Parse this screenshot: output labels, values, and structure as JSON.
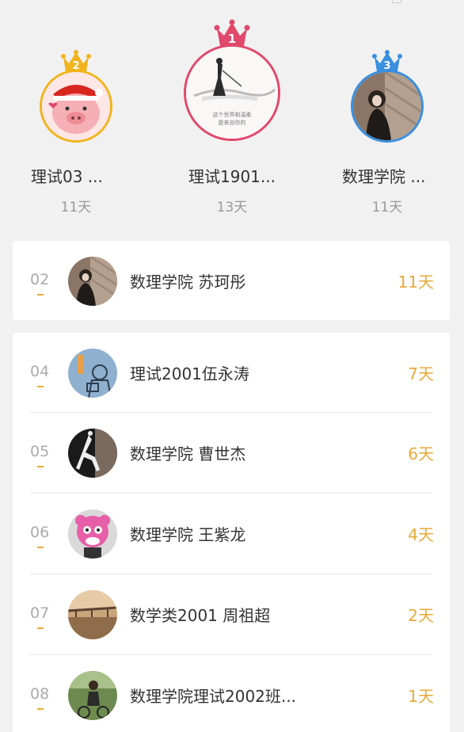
{
  "colors": {
    "gold": "#e8a93a",
    "first": "#e0496b",
    "second": "#f1b41d",
    "third": "#3a8fe0"
  },
  "podium": [
    {
      "rank": "2",
      "name": "理试03 ...",
      "days": "11天",
      "avatar_icon": "pig-avatar-icon"
    },
    {
      "rank": "1",
      "name": "理试1901...",
      "days": "13天",
      "avatar_icon": "ink-painting-avatar-icon"
    },
    {
      "rank": "3",
      "name": "数理学院 ...",
      "days": "11天",
      "avatar_icon": "girl-photo-avatar-icon"
    }
  ],
  "my_rank": {
    "rank": "02",
    "name": "数理学院 苏珂彤",
    "days": "11天"
  },
  "list": [
    {
      "rank": "04",
      "name": "理试2001伍永涛",
      "days": "7天"
    },
    {
      "rank": "05",
      "name": "数理学院 曹世杰",
      "days": "6天"
    },
    {
      "rank": "06",
      "name": "数理学院 王紫龙",
      "days": "4天"
    },
    {
      "rank": "07",
      "name": "数学类2001 周祖超",
      "days": "2天"
    },
    {
      "rank": "08",
      "name": "数理学院理试2002班...",
      "days": "1天"
    }
  ]
}
